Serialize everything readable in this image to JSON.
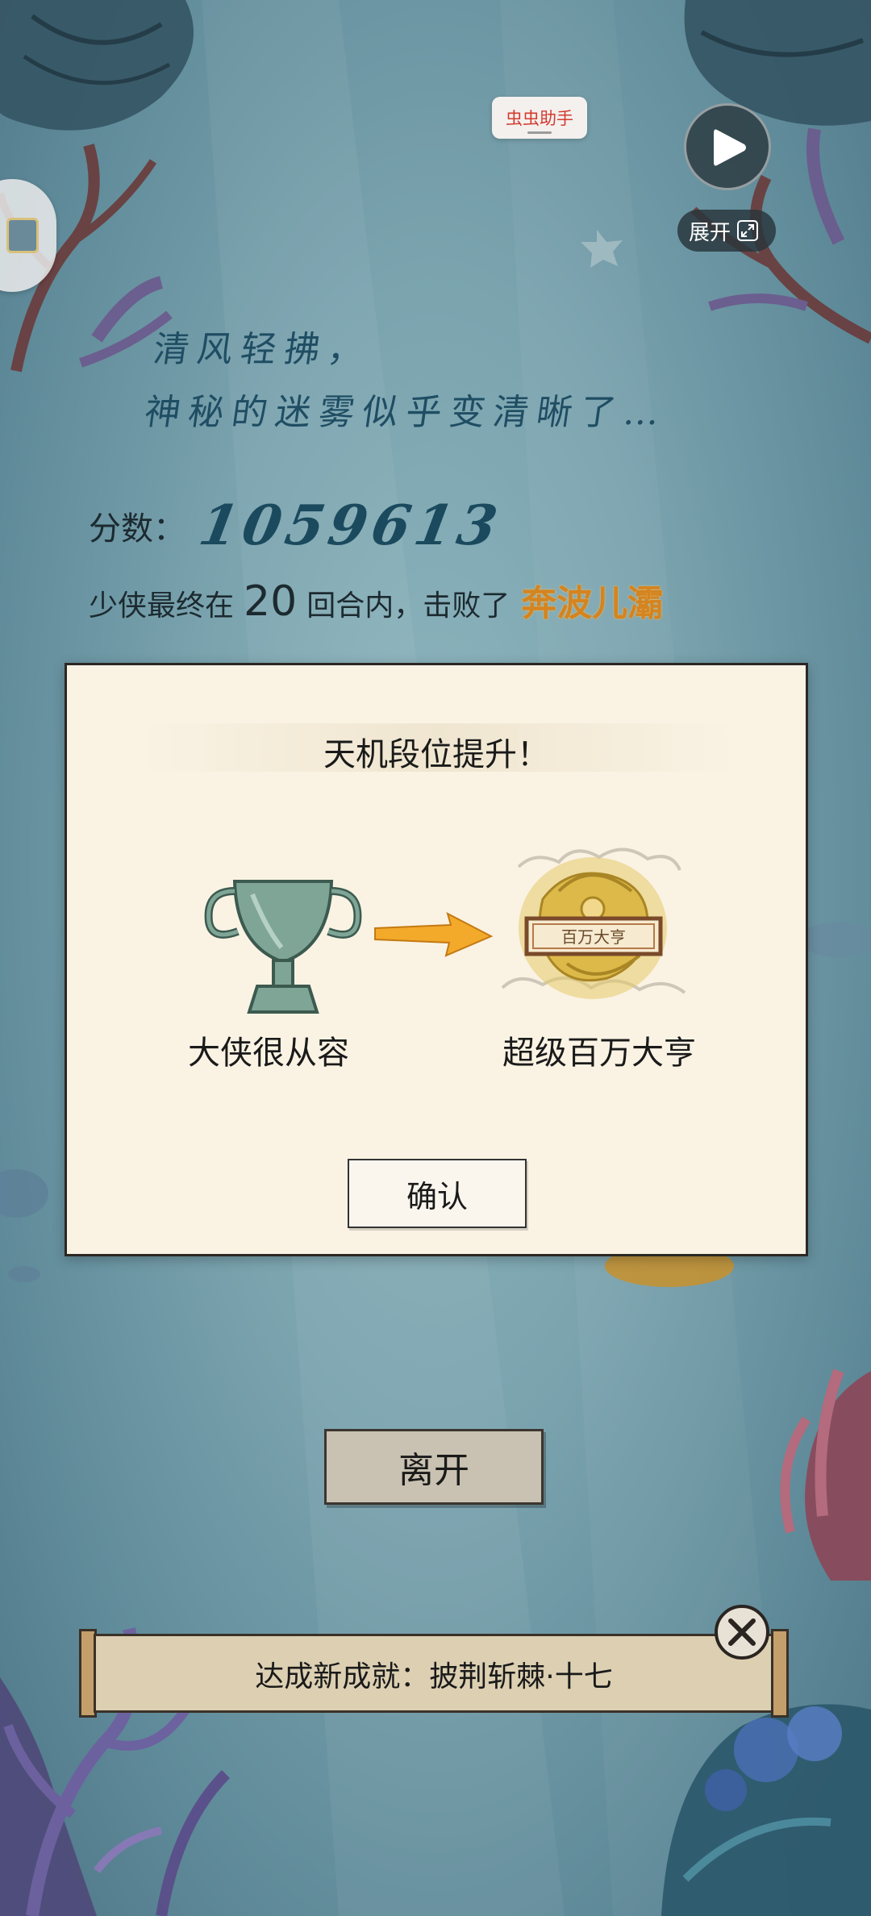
{
  "overlay": {
    "helper_label": "虫虫助手",
    "expand_label": "展开"
  },
  "poem": {
    "line1": "清风轻拂，",
    "line2": "神秘的迷雾似乎变清晰了…"
  },
  "result": {
    "score_label": "分数：",
    "score_value": "1059613",
    "prefix": "少侠最终在",
    "rounds": "20",
    "middle": "回合内，击败了",
    "enemy": "奔波儿灞"
  },
  "dialog": {
    "title": "天机段位提升！",
    "old_rank": "大侠很从容",
    "new_rank": "超级百万大亨",
    "badge_text": "百万大亨",
    "confirm_label": "确认"
  },
  "leave_label": "离开",
  "achievement": {
    "text": "达成新成就：披荆斩棘·十七"
  },
  "colors": {
    "accent_orange": "#d48420",
    "dialog_bg": "#faf3e4",
    "score_blue": "#1b4a5e"
  }
}
